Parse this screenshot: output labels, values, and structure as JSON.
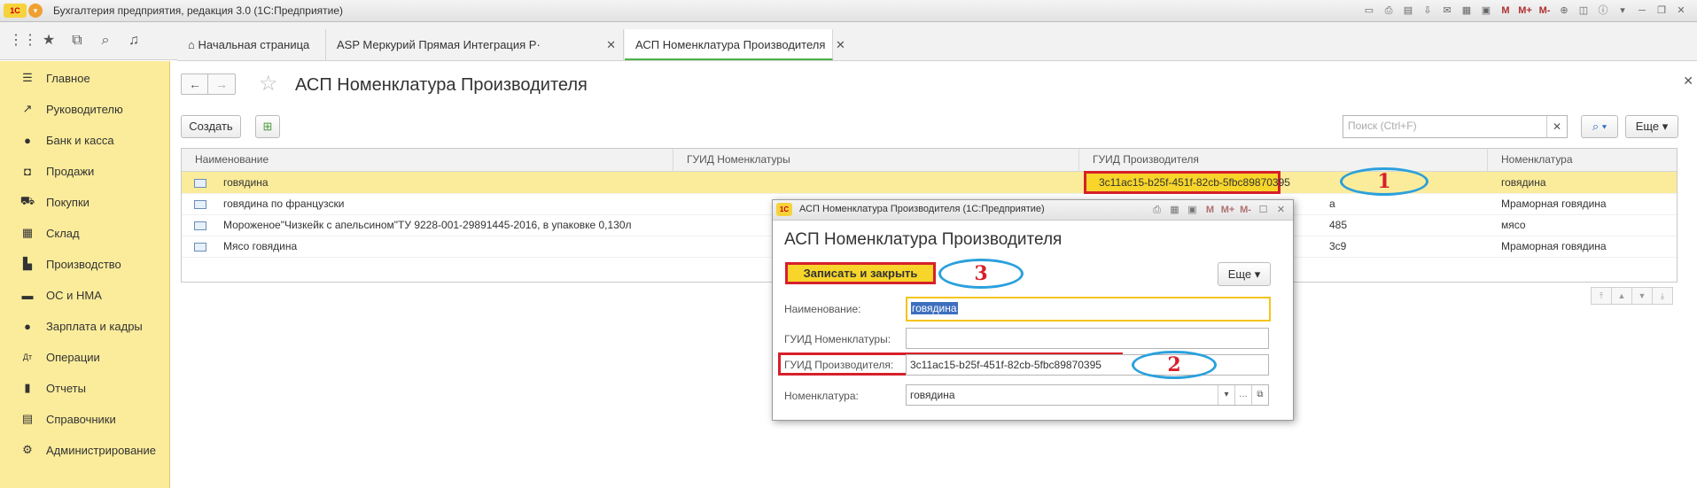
{
  "app": {
    "title": "Бухгалтерия предприятия, редакция 3.0  (1С:Предприятие)",
    "logo": "1С",
    "toolbar_m": "M",
    "toolbar_mplus": "M+",
    "toolbar_mminus": "M-"
  },
  "tabs": [
    {
      "label": "Начальная страница"
    },
    {
      "label": "ASP Меркурий Прямая Интеграция Р·"
    },
    {
      "label": "АСП Номенклатура Производителя"
    }
  ],
  "sidebar": {
    "items": [
      {
        "label": "Главное",
        "icon": "menu-lines-icon"
      },
      {
        "label": "Руководителю",
        "icon": "trend-icon"
      },
      {
        "label": "Банк и касса",
        "icon": "coin-icon"
      },
      {
        "label": "Продажи",
        "icon": "bag-icon"
      },
      {
        "label": "Покупки",
        "icon": "cart-icon"
      },
      {
        "label": "Склад",
        "icon": "grid-icon"
      },
      {
        "label": "Производство",
        "icon": "factory-icon"
      },
      {
        "label": "ОС и НМА",
        "icon": "truck-icon"
      },
      {
        "label": "Зарплата и кадры",
        "icon": "person-icon"
      },
      {
        "label": "Операции",
        "icon": "dt-kt-icon"
      },
      {
        "label": "Отчеты",
        "icon": "bar-chart-icon"
      },
      {
        "label": "Справочники",
        "icon": "book-icon"
      },
      {
        "label": "Администрирование",
        "icon": "gear-icon"
      }
    ]
  },
  "main": {
    "title": "АСП Номенклатура Производителя",
    "create_label": "Создать",
    "search_placeholder": "Поиск (Ctrl+F)",
    "more_label": "Еще"
  },
  "table": {
    "columns": [
      "Наименование",
      "ГУИД Номенклатуры",
      "ГУИД Производителя",
      "Номенклатура"
    ],
    "rows": [
      {
        "name": "говядина",
        "guid_nom": "",
        "guid_prod": "3c11ac15-b25f-451f-82cb-5fbc89870395",
        "nomen": "говядина"
      },
      {
        "name": "говядина по французски",
        "guid_nom": "",
        "guid_prod": "a",
        "nomen": "Мраморная говядина"
      },
      {
        "name": "Мороженое\"Чизкейк с апельсином\"ТУ 9228-001-29891445-2016, в упаковке 0,130л",
        "guid_nom": "",
        "guid_prod": "485",
        "nomen": "мясо"
      },
      {
        "name": "Мясо говядина",
        "guid_nom": "",
        "guid_prod": "3c9",
        "nomen": "Мраморная говядина"
      }
    ]
  },
  "dialog": {
    "window_title": "АСП Номенклатура Производителя  (1С:Предприятие)",
    "title": "АСП Номенклатура Производителя",
    "save_close_label": "Записать и закрыть",
    "more_label": "Еще",
    "fields": {
      "name_label": "Наименование:",
      "name_value": "говядина",
      "guid_nom_label": "ГУИД Номенклатуры:",
      "guid_nom_value": "",
      "guid_prod_label": "ГУИД Производителя:",
      "guid_prod_value": "3c11ac15-b25f-451f-82cb-5fbc89870395",
      "nomen_label": "Номенклатура:",
      "nomen_value": "говядина"
    }
  },
  "annotations": {
    "one": "1",
    "two": "2",
    "three": "3"
  },
  "colors": {
    "accent_yellow": "#fbec9b",
    "highlight_red": "#d6202b",
    "callout_blue": "#2aa0dc",
    "tab_green": "#4bb34b"
  }
}
